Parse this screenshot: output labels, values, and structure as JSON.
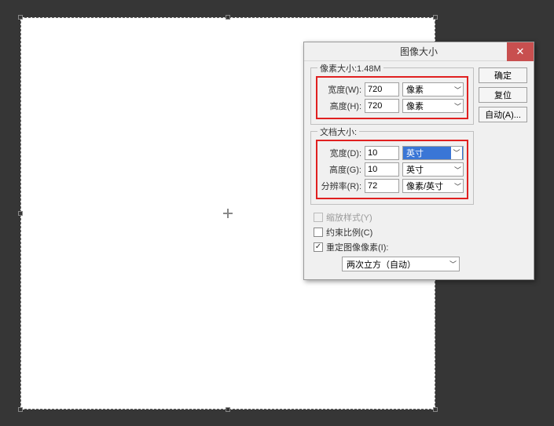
{
  "dialog": {
    "title": "图像大小",
    "close_glyph": "✕",
    "buttons": {
      "ok": "确定",
      "reset": "复位",
      "auto": "自动(A)..."
    },
    "pixel_group": {
      "title": "像素大小:1.48M",
      "width_label": "宽度(W):",
      "width_value": "720",
      "width_unit": "像素",
      "height_label": "高度(H):",
      "height_value": "720",
      "height_unit": "像素"
    },
    "doc_group": {
      "title": "文档大小:",
      "width_label": "宽度(D):",
      "width_value": "10",
      "width_unit": "英寸",
      "height_label": "高度(G):",
      "height_value": "10",
      "height_unit": "英寸",
      "res_label": "分辨率(R):",
      "res_value": "72",
      "res_unit": "像素/英寸"
    },
    "scale_styles_label": "缩放样式(Y)",
    "constrain_label": "约束比例(C)",
    "resample_label": "重定图像像素(I):",
    "resample_method": "两次立方（自动）"
  }
}
